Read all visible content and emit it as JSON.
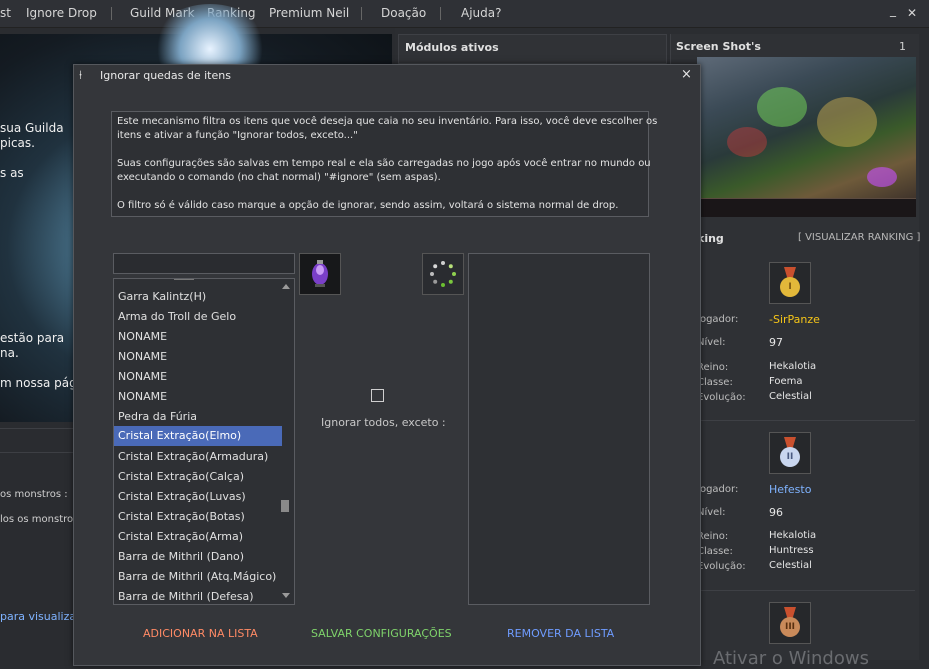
{
  "topmenu": {
    "items": [
      "st",
      "Ignore Drop",
      "Guild Mark",
      "Ranking",
      "Premium Neil",
      "Doação",
      "Ajuda?"
    ],
    "minimize": "_",
    "close": "✕"
  },
  "left": {
    "texts": [
      "sua Guilda",
      "picas.",
      "s as",
      "estão para",
      "na.",
      "m nossa págin"
    ],
    "small1": "os monstros :",
    "small2": "los os monstros",
    "link": "para visualizar"
  },
  "modules": {
    "title": "Módulos ativos"
  },
  "screenshots": {
    "title": "Screen Shot's",
    "count": "1"
  },
  "ranking": {
    "title": "king",
    "link": "[ VISUALIZAR RANKING ]",
    "players": [
      {
        "medal": "I",
        "player_label": "Jogador:",
        "player": "-SirPanze",
        "level_label": "Nível:",
        "level": "97",
        "realm_label": "Reino:",
        "realm": "Hekalotia",
        "class_label": "Classe:",
        "class": "Foema",
        "evo_label": "Evolução:",
        "evo": "Celestial"
      },
      {
        "medal": "II",
        "player_label": "Jogador:",
        "player": "Hefesto",
        "level_label": "Nível:",
        "level": "96",
        "realm_label": "Reino:",
        "realm": "Hekalotia",
        "class_label": "Classe:",
        "class": "Huntress",
        "evo_label": "Evolução:",
        "evo": "Celestial"
      },
      {
        "medal": "III"
      }
    ],
    "colors": {
      "first": "#f5c518",
      "second": "#7fb3ff"
    }
  },
  "watermark": "Ativar o Windows",
  "dialog": {
    "title": "Ignorar quedas de itens",
    "close": "×",
    "info": [
      "Este mecanismo filtra os itens que você deseja que caia no seu inventário. Para isso, você deve escolher os",
      "itens e ativar a função \"Ignorar todos, exceto...\"",
      "",
      "Suas configurações são salvas em tempo real e ela são carregadas no jogo após você entrar no mundo ou",
      "executando o comando (no chat normal) \"#ignore\" (sem aspas).",
      "",
      "O filtro só é válido caso marque a opção de ignorar, sendo assim, voltará o sistema normal de drop."
    ],
    "search_value": "",
    "items": [
      "Garra Kalintz(H)",
      "Arma do Troll de Gelo",
      "NONAME",
      "NONAME",
      "NONAME",
      "NONAME",
      "Pedra da Fúria",
      "Cristal Extração(Elmo)",
      "Cristal Extração(Armadura)",
      "Cristal Extração(Calça)",
      "Cristal Extração(Luvas)",
      "Cristal Extração(Botas)",
      "Cristal Extração(Arma)",
      "Barra de Mithril (Dano)",
      "Barra de Mithril (Atq.Mágico)",
      "Barra de Mithril (Defesa)"
    ],
    "selected_index": 7,
    "checkbox_label": "Ignorar todos, exceto :",
    "checkbox_checked": false,
    "buttons": {
      "add": "ADICIONAR NA LISTA",
      "save": "SALVAR CONFIGURAÇÕES",
      "remove": "REMOVER DA LISTA"
    },
    "button_colors": {
      "add": "#ff8a65",
      "save": "#7fd36b",
      "remove": "#6f9cff"
    }
  }
}
